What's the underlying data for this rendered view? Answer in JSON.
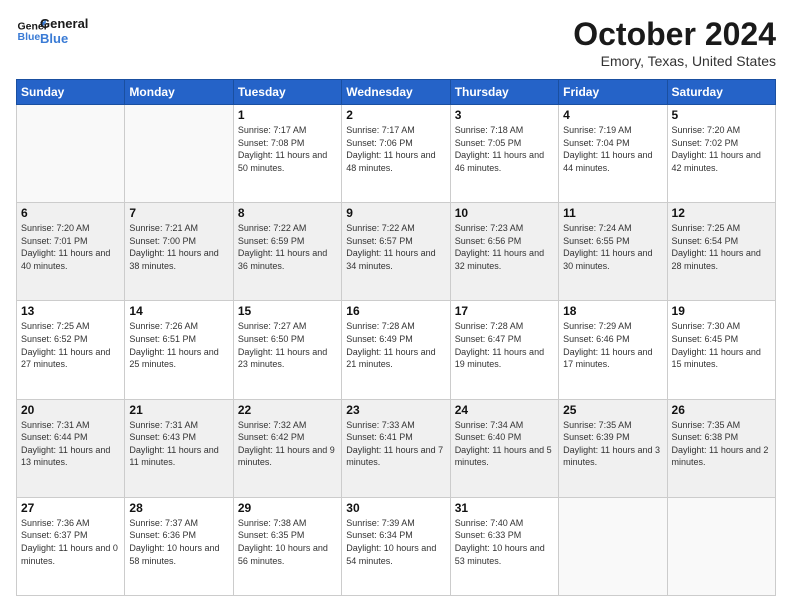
{
  "logo": {
    "line1": "General",
    "line2": "Blue"
  },
  "title": "October 2024",
  "location": "Emory, Texas, United States",
  "days_of_week": [
    "Sunday",
    "Monday",
    "Tuesday",
    "Wednesday",
    "Thursday",
    "Friday",
    "Saturday"
  ],
  "weeks": [
    [
      {
        "day": "",
        "info": ""
      },
      {
        "day": "",
        "info": ""
      },
      {
        "day": "1",
        "info": "Sunrise: 7:17 AM\nSunset: 7:08 PM\nDaylight: 11 hours and 50 minutes."
      },
      {
        "day": "2",
        "info": "Sunrise: 7:17 AM\nSunset: 7:06 PM\nDaylight: 11 hours and 48 minutes."
      },
      {
        "day": "3",
        "info": "Sunrise: 7:18 AM\nSunset: 7:05 PM\nDaylight: 11 hours and 46 minutes."
      },
      {
        "day": "4",
        "info": "Sunrise: 7:19 AM\nSunset: 7:04 PM\nDaylight: 11 hours and 44 minutes."
      },
      {
        "day": "5",
        "info": "Sunrise: 7:20 AM\nSunset: 7:02 PM\nDaylight: 11 hours and 42 minutes."
      }
    ],
    [
      {
        "day": "6",
        "info": "Sunrise: 7:20 AM\nSunset: 7:01 PM\nDaylight: 11 hours and 40 minutes."
      },
      {
        "day": "7",
        "info": "Sunrise: 7:21 AM\nSunset: 7:00 PM\nDaylight: 11 hours and 38 minutes."
      },
      {
        "day": "8",
        "info": "Sunrise: 7:22 AM\nSunset: 6:59 PM\nDaylight: 11 hours and 36 minutes."
      },
      {
        "day": "9",
        "info": "Sunrise: 7:22 AM\nSunset: 6:57 PM\nDaylight: 11 hours and 34 minutes."
      },
      {
        "day": "10",
        "info": "Sunrise: 7:23 AM\nSunset: 6:56 PM\nDaylight: 11 hours and 32 minutes."
      },
      {
        "day": "11",
        "info": "Sunrise: 7:24 AM\nSunset: 6:55 PM\nDaylight: 11 hours and 30 minutes."
      },
      {
        "day": "12",
        "info": "Sunrise: 7:25 AM\nSunset: 6:54 PM\nDaylight: 11 hours and 28 minutes."
      }
    ],
    [
      {
        "day": "13",
        "info": "Sunrise: 7:25 AM\nSunset: 6:52 PM\nDaylight: 11 hours and 27 minutes."
      },
      {
        "day": "14",
        "info": "Sunrise: 7:26 AM\nSunset: 6:51 PM\nDaylight: 11 hours and 25 minutes."
      },
      {
        "day": "15",
        "info": "Sunrise: 7:27 AM\nSunset: 6:50 PM\nDaylight: 11 hours and 23 minutes."
      },
      {
        "day": "16",
        "info": "Sunrise: 7:28 AM\nSunset: 6:49 PM\nDaylight: 11 hours and 21 minutes."
      },
      {
        "day": "17",
        "info": "Sunrise: 7:28 AM\nSunset: 6:47 PM\nDaylight: 11 hours and 19 minutes."
      },
      {
        "day": "18",
        "info": "Sunrise: 7:29 AM\nSunset: 6:46 PM\nDaylight: 11 hours and 17 minutes."
      },
      {
        "day": "19",
        "info": "Sunrise: 7:30 AM\nSunset: 6:45 PM\nDaylight: 11 hours and 15 minutes."
      }
    ],
    [
      {
        "day": "20",
        "info": "Sunrise: 7:31 AM\nSunset: 6:44 PM\nDaylight: 11 hours and 13 minutes."
      },
      {
        "day": "21",
        "info": "Sunrise: 7:31 AM\nSunset: 6:43 PM\nDaylight: 11 hours and 11 minutes."
      },
      {
        "day": "22",
        "info": "Sunrise: 7:32 AM\nSunset: 6:42 PM\nDaylight: 11 hours and 9 minutes."
      },
      {
        "day": "23",
        "info": "Sunrise: 7:33 AM\nSunset: 6:41 PM\nDaylight: 11 hours and 7 minutes."
      },
      {
        "day": "24",
        "info": "Sunrise: 7:34 AM\nSunset: 6:40 PM\nDaylight: 11 hours and 5 minutes."
      },
      {
        "day": "25",
        "info": "Sunrise: 7:35 AM\nSunset: 6:39 PM\nDaylight: 11 hours and 3 minutes."
      },
      {
        "day": "26",
        "info": "Sunrise: 7:35 AM\nSunset: 6:38 PM\nDaylight: 11 hours and 2 minutes."
      }
    ],
    [
      {
        "day": "27",
        "info": "Sunrise: 7:36 AM\nSunset: 6:37 PM\nDaylight: 11 hours and 0 minutes."
      },
      {
        "day": "28",
        "info": "Sunrise: 7:37 AM\nSunset: 6:36 PM\nDaylight: 10 hours and 58 minutes."
      },
      {
        "day": "29",
        "info": "Sunrise: 7:38 AM\nSunset: 6:35 PM\nDaylight: 10 hours and 56 minutes."
      },
      {
        "day": "30",
        "info": "Sunrise: 7:39 AM\nSunset: 6:34 PM\nDaylight: 10 hours and 54 minutes."
      },
      {
        "day": "31",
        "info": "Sunrise: 7:40 AM\nSunset: 6:33 PM\nDaylight: 10 hours and 53 minutes."
      },
      {
        "day": "",
        "info": ""
      },
      {
        "day": "",
        "info": ""
      }
    ]
  ]
}
